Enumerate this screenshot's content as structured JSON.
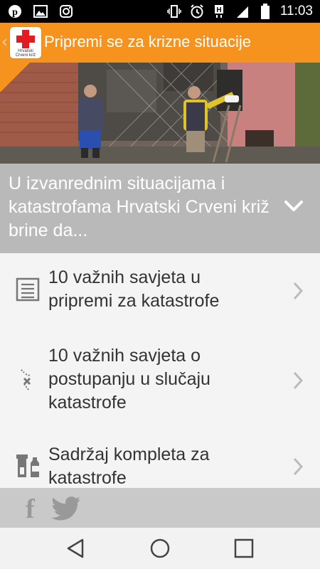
{
  "status_bar": {
    "time": "11:03",
    "left_icons": [
      "pinterest-icon",
      "gallery-icon",
      "instagram-icon"
    ],
    "right_icons": [
      "vibrate-icon",
      "alarm-icon",
      "h-signal-icon",
      "signal-icon",
      "battery-icon"
    ]
  },
  "app_bar": {
    "title": "Pripremi se za krizne situacije",
    "logo_text_line1": "Hrvatski",
    "logo_text_line2": "Crveni križ",
    "accent_color": "#f6921e"
  },
  "intro": {
    "text": "U izvanrednim situacijama i katastrofama Hrvatski Crveni križ brine da..."
  },
  "list": {
    "items": [
      {
        "label": "10 važnih savjeta u pripremi za katastrofe",
        "icon": "checklist-icon"
      },
      {
        "label": "10 važnih savjeta o postupanju u slučaju katastrofe",
        "icon": "route-icon"
      },
      {
        "label": "Sadržaj kompleta za katastrofe",
        "icon": "flashlight-bottle-icon"
      }
    ]
  },
  "social": {
    "facebook": "f",
    "icons": [
      "facebook-icon",
      "twitter-icon"
    ]
  },
  "nav": {
    "buttons": [
      "back-icon",
      "home-icon",
      "recents-icon"
    ]
  }
}
